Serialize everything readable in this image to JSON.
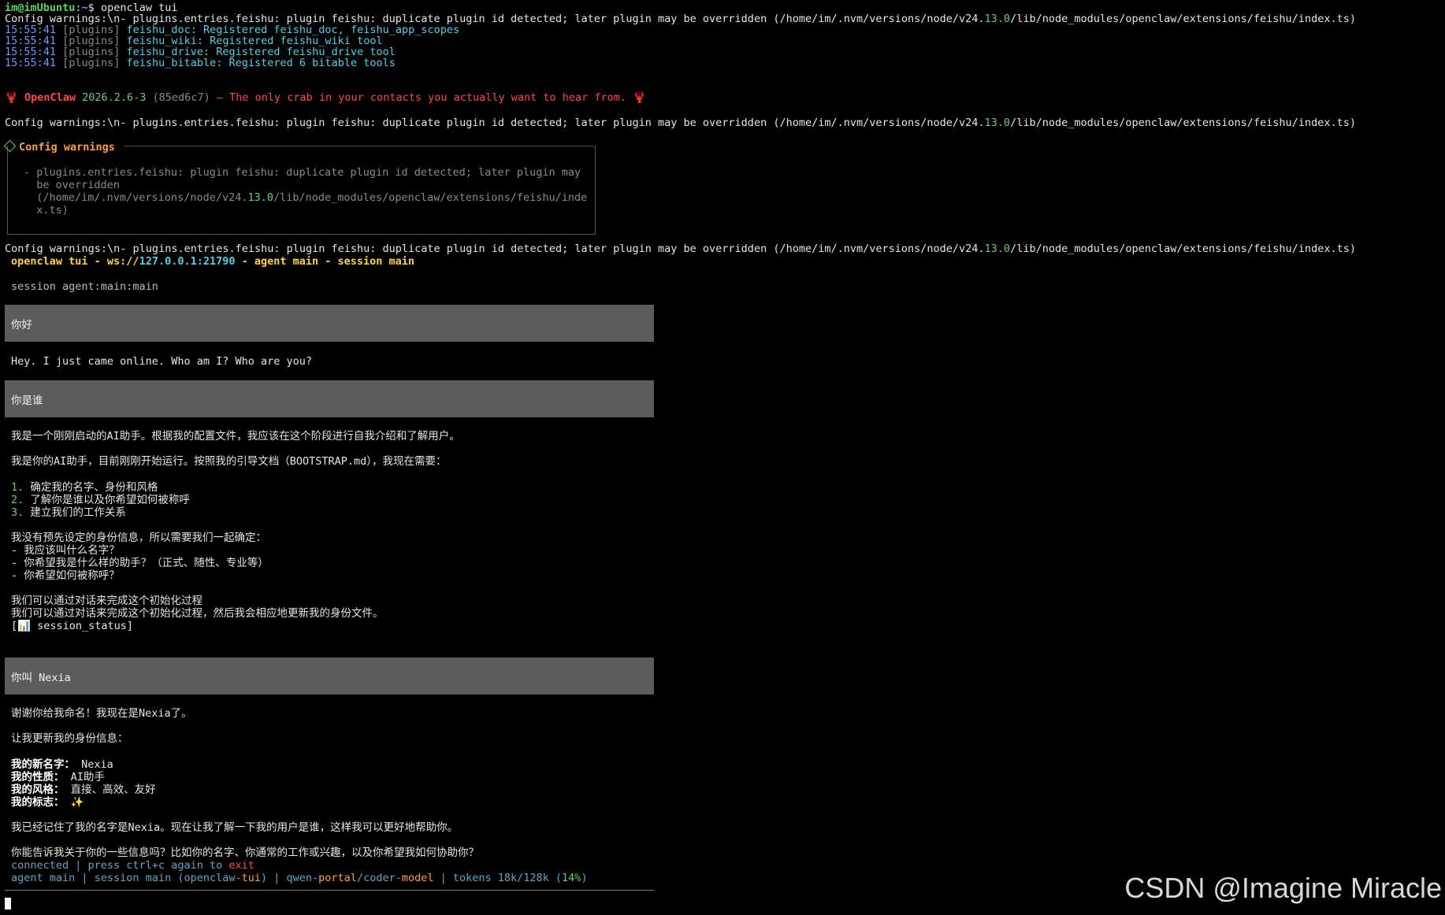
{
  "shell": {
    "user_host": "im@imUbuntu",
    "path": ":~",
    "prompt": "$ ",
    "command": "openclaw tui"
  },
  "config_warning": {
    "pre": "Config warnings:\\n- plugins.entries.feishu: plugin feishu: duplicate plugin id detected; later plugin may be overridden (/home/im/.nvm/versions/node/v24.",
    "ver": "13.0",
    "post": "/lib/node_modules/openclaw/extensions/feishu/index.ts)"
  },
  "plugin_logs": [
    {
      "time": "15:55:41",
      "tag": "[plugins]",
      "name": "feishu_doc",
      "msg": ": Registered feishu_doc, feishu_app_scopes"
    },
    {
      "time": "15:55:41",
      "tag": "[plugins]",
      "name": "feishu_wiki",
      "msg": ": Registered feishu_wiki tool"
    },
    {
      "time": "15:55:41",
      "tag": "[plugins]",
      "name": "feishu_drive",
      "msg": ": Registered feishu_drive tool"
    },
    {
      "time": "15:55:41",
      "tag": "[plugins]",
      "name": "feishu_bitable",
      "msg": ": Registered 6 bitable tools"
    }
  ],
  "banner": {
    "emoji": "🦞",
    "name": "OpenClaw",
    "version": "2026.2.6-3",
    "hash": "(85ed6c7)",
    "dash": "—",
    "tagline": "The only crab in your contacts you actually want to hear from."
  },
  "warn_box": {
    "title": "Config warnings",
    "l1": "- plugins.entries.feishu: plugin feishu: duplicate plugin id detected; later plugin may",
    "l2": "  be overridden",
    "l3a": "  (/home/im/.nvm/versions/node/v24.",
    "l3b": "13.0",
    "l3c": "/lib/node_modules/openclaw/extensions/feishu/inde",
    "l4": "  x.ts)"
  },
  "tui_header": {
    "a": "openclaw tui - ws://",
    "host": "127.0.0.1:21790",
    "b": " - agent main - session main"
  },
  "session_line": "session agent:main:main",
  "messages": {
    "u1": "你好",
    "a1": "Hey. I just came online. Who am I? Who are you?",
    "u2": "你是谁",
    "a2_l1": "我是一个刚刚启动的AI助手。根据我的配置文件，我应该在这个阶段进行自我介绍和了解用户。",
    "a2_l2": "我是你的AI助手，目前刚刚开始运行。按照我的引导文档（BOOTSTRAP.md），我现在需要：",
    "a2_n1": "1.",
    "a2_i1": " 确定我的名字、身份和风格",
    "a2_n2": "2.",
    "a2_i2": " 了解你是谁以及你希望如何被称呼",
    "a2_n3": "3.",
    "a2_i3": " 建立我们的工作关系",
    "a2_l3": "我没有预先设定的身份信息，所以需要我们一起确定：",
    "a2_d1": "- 我应该叫什么名字？",
    "a2_d2": "- 你希望我是什么样的助手？（正式、随性、专业等）",
    "a2_d3": "- 你希望如何被称呼？",
    "a2_l4": "我们可以通过对话来完成这个初始化过程",
    "a2_l5": "我们可以通过对话来完成这个初始化过程，然后我会相应地更新我的身份文件。",
    "a2_tool_open": "[",
    "a2_tool_icon": "📊",
    "a2_tool": " session_status]",
    "u3": "你叫 Nexia",
    "a3_l1": "谢谢你给我命名！我现在是Nexia了。",
    "a3_l2": "让我更新我的身份信息：",
    "a3_k1": "我的新名字：",
    "a3_v1": " Nexia",
    "a3_k2": "我的性质：",
    "a3_v2": " AI助手",
    "a3_k3": "我的风格：",
    "a3_v3": " 直接、高效、友好",
    "a3_k4": "我的标志：",
    "a3_v4": " ✨",
    "a3_l3": "我已经记住了我的名字是Nexia。现在让我了解一下我的用户是谁，这样我可以更好地帮助你。",
    "a3_l4": "你能告诉我关于你的一些信息吗？比如你的名字、你通常的工作或兴趣，以及你希望我如何协助你？"
  },
  "status": {
    "l1a": "connected | press ctrl+c again to ",
    "l1b": "exit",
    "agent": "agent main | session main (openclaw-",
    "tui": "tui",
    "p1": ") | qwen-",
    "portal": "portal",
    "slash": "/coder-",
    "model": "model",
    "tokens": " | tokens 18k/128k (",
    "pct": "14%",
    "close": ")"
  },
  "watermark": "CSDN @Imagine Miracle"
}
